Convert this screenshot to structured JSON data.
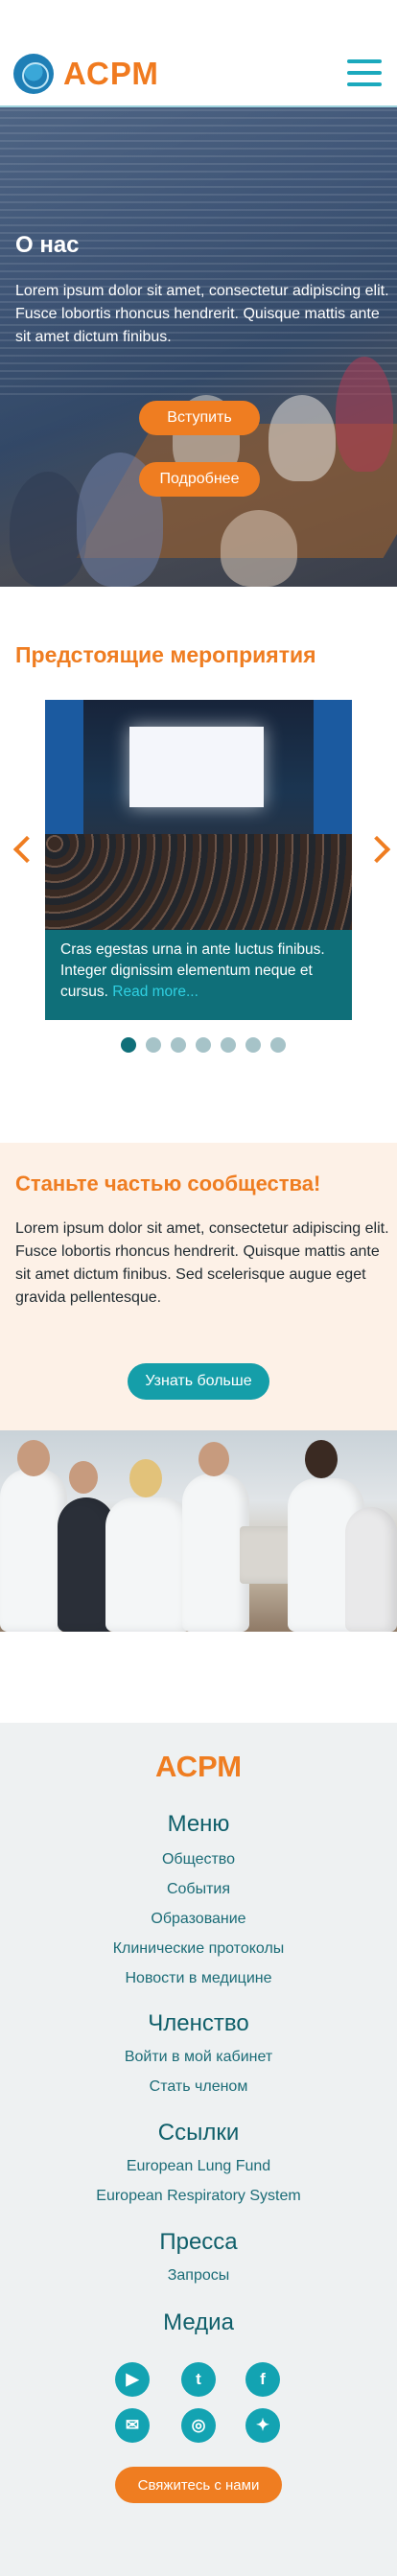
{
  "header": {
    "brand": "АСРМ",
    "logo_icon": "lungs-globe-logo",
    "menu_icon": "hamburger-menu-icon"
  },
  "hero": {
    "title": "О нас",
    "text": "Lorem ipsum dolor sit amet, consectetur adipiscing elit. Fusce lobortis rhoncus hendrerit. Quisque mattis ante sit amet dictum finibus.",
    "join_button": "Вступить",
    "more_button": "Подробнее"
  },
  "events": {
    "title": "Предстоящие мероприятия",
    "caption": "Cras egestas urna in ante luctus finibus. Integer dignissim elementum neque et cursus.",
    "read_more": "Read more...",
    "dots_count": 7,
    "active_dot": 1
  },
  "join": {
    "title": "Станьте частью сообщества!",
    "text": "Lorem ipsum dolor sit amet, consectetur adipiscing elit. Fusce lobortis rhoncus hendrerit. Quisque mattis ante sit amet dictum finibus. Sed scelerisque augue eget gravida pellentesque.",
    "button": "Узнать больше"
  },
  "footer": {
    "brand": "АСРМ",
    "menu_heading": "Меню",
    "menu_items": [
      "Общество",
      "События",
      "Образование",
      "Клинические протоколы",
      "Новости в медицине"
    ],
    "membership_heading": "Членство",
    "membership_items": [
      "Войти в мой кабинет",
      "Стать членом"
    ],
    "links_heading": "Ссылки",
    "links_items": [
      "European Lung Fund",
      "European Respiratory System"
    ],
    "press_heading": "Пресса",
    "press_items": [
      "Запросы"
    ],
    "media_heading": "Медиа",
    "social_icons": [
      "youtube-icon",
      "tumblr-icon",
      "facebook-icon",
      "messenger-icon",
      "instagram-icon",
      "twitter-icon"
    ],
    "contact_button": "Свяжитесь с нами"
  },
  "colors": {
    "accent_orange": "#ef7d21",
    "teal": "#159ea9",
    "dark_teal": "#0f6f79"
  }
}
